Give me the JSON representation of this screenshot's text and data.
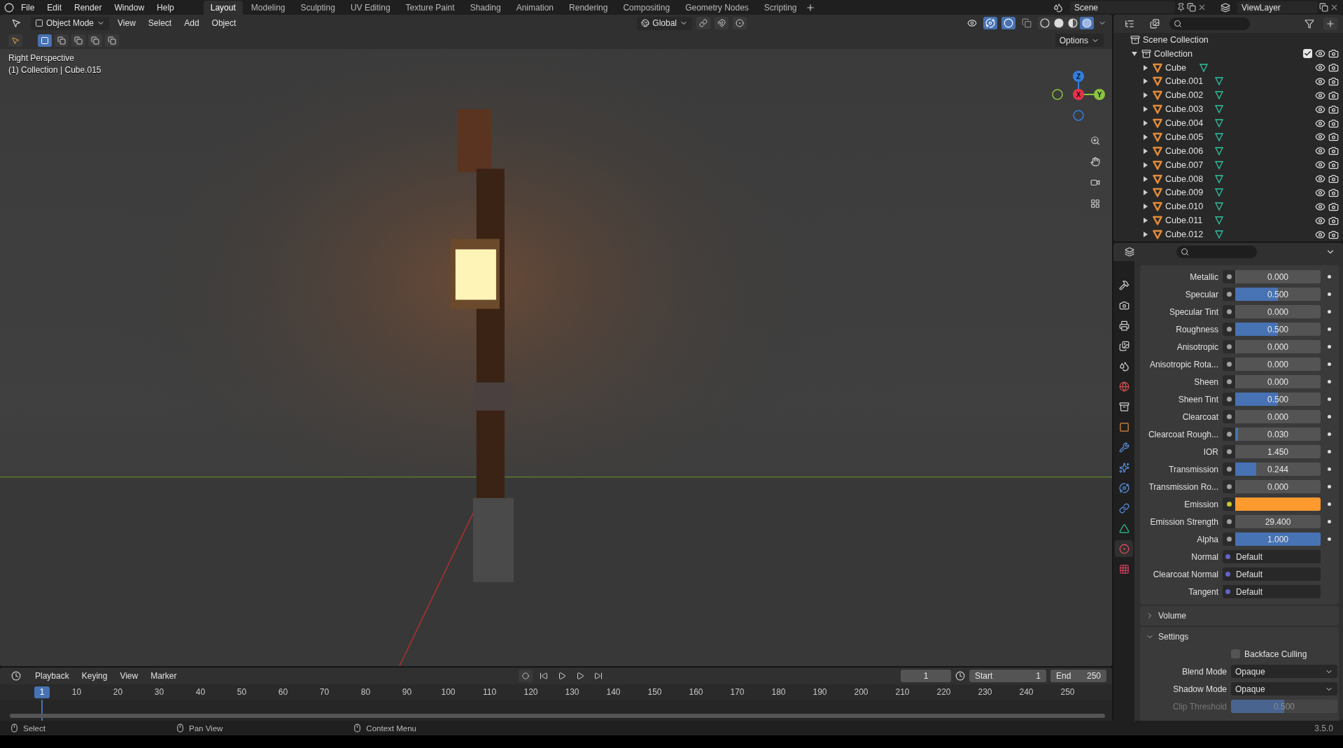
{
  "menu": [
    "File",
    "Edit",
    "Render",
    "Window",
    "Help"
  ],
  "workspaces": [
    {
      "label": "Layout",
      "selected": true
    },
    {
      "label": "Modeling",
      "selected": false
    },
    {
      "label": "Sculpting",
      "selected": false
    },
    {
      "label": "UV Editing",
      "selected": false
    },
    {
      "label": "Texture Paint",
      "selected": false
    },
    {
      "label": "Shading",
      "selected": false
    },
    {
      "label": "Animation",
      "selected": false
    },
    {
      "label": "Rendering",
      "selected": false
    },
    {
      "label": "Compositing",
      "selected": false
    },
    {
      "label": "Geometry Nodes",
      "selected": false
    },
    {
      "label": "Scripting",
      "selected": false
    }
  ],
  "scene": "Scene",
  "view_layer": "ViewLayer",
  "viewport": {
    "mode": "Object Mode",
    "menus": [
      "View",
      "Select",
      "Add",
      "Object"
    ],
    "orientation": "Global",
    "options": "Options",
    "info": [
      "Right Perspective",
      "(1) Collection | Cube.015"
    ],
    "axes": [
      {
        "label": "Z",
        "color": "#2f7fe0"
      },
      {
        "label": "X",
        "color": "#e8334a"
      },
      {
        "label": "Y",
        "color": "#8ac53f"
      }
    ],
    "shading": [
      {
        "kind": "wireframe",
        "selected": false
      },
      {
        "kind": "solid",
        "selected": false
      },
      {
        "kind": "material",
        "selected": false
      },
      {
        "kind": "rendered",
        "selected": true
      }
    ]
  },
  "outliner": {
    "items": [
      {
        "label": "Scene Collection",
        "kind": "scene",
        "children": [
          {
            "label": "Collection",
            "kind": "collection",
            "expanded": true,
            "checked": true,
            "children": [
              {
                "label": "Cube",
                "kind": "object",
                "expanded": false
              },
              {
                "label": "Cube.001",
                "kind": "object",
                "expanded": false
              },
              {
                "label": "Cube.002",
                "kind": "object",
                "expanded": false
              },
              {
                "label": "Cube.003",
                "kind": "object",
                "expanded": false
              },
              {
                "label": "Cube.004",
                "kind": "object",
                "expanded": false
              },
              {
                "label": "Cube.005",
                "kind": "object",
                "expanded": false
              },
              {
                "label": "Cube.006",
                "kind": "object",
                "expanded": false
              },
              {
                "label": "Cube.007",
                "kind": "object",
                "expanded": false
              },
              {
                "label": "Cube.008",
                "kind": "object",
                "expanded": false
              },
              {
                "label": "Cube.009",
                "kind": "object",
                "expanded": false
              },
              {
                "label": "Cube.010",
                "kind": "object",
                "expanded": false
              },
              {
                "label": "Cube.011",
                "kind": "object",
                "expanded": false
              },
              {
                "label": "Cube.012",
                "kind": "object",
                "expanded": false
              }
            ]
          }
        ]
      }
    ]
  },
  "property_tabs": [
    {
      "kind": "tool",
      "selected": false
    },
    {
      "kind": "render",
      "selected": false
    },
    {
      "kind": "output",
      "selected": false
    },
    {
      "kind": "view_layer",
      "selected": false
    },
    {
      "kind": "scene",
      "selected": false
    },
    {
      "kind": "world",
      "selected": false
    },
    {
      "kind": "collection",
      "selected": false
    },
    {
      "kind": "object",
      "selected": false
    },
    {
      "kind": "modifiers",
      "selected": false
    },
    {
      "kind": "particles",
      "selected": false
    },
    {
      "kind": "physics",
      "selected": false
    },
    {
      "kind": "constraints",
      "selected": false
    },
    {
      "kind": "data",
      "selected": false
    },
    {
      "kind": "material",
      "selected": true
    },
    {
      "kind": "texture",
      "selected": false
    }
  ],
  "properties": [
    {
      "label": "Metallic",
      "kind": "slider",
      "value": "0.000",
      "level": 0
    },
    {
      "label": "Specular",
      "kind": "slider",
      "value": "0.500",
      "level": 0.5
    },
    {
      "label": "Specular Tint",
      "kind": "slider",
      "value": "0.000",
      "level": 0
    },
    {
      "label": "Roughness",
      "kind": "slider",
      "value": "0.500",
      "level": 0.5
    },
    {
      "label": "Anisotropic",
      "kind": "slider",
      "value": "0.000",
      "level": 0
    },
    {
      "label": "Anisotropic Rota...",
      "kind": "slider",
      "value": "0.000",
      "level": 0
    },
    {
      "label": "Sheen",
      "kind": "slider",
      "value": "0.000",
      "level": 0
    },
    {
      "label": "Sheen Tint",
      "kind": "slider",
      "value": "0.500",
      "level": 0.5
    },
    {
      "label": "Clearcoat",
      "kind": "slider",
      "value": "0.000",
      "level": 0
    },
    {
      "label": "Clearcoat Rough...",
      "kind": "slider",
      "value": "0.030",
      "level": 0.03
    },
    {
      "label": "IOR",
      "kind": "number",
      "value": "1.450"
    },
    {
      "label": "Transmission",
      "kind": "slider",
      "value": "0.244",
      "level": 0.244
    },
    {
      "label": "Transmission Ro...",
      "kind": "slider",
      "value": "0.000",
      "level": 0
    },
    {
      "label": "Emission",
      "kind": "color",
      "color": "#ff9a2e"
    },
    {
      "label": "Emission Strength",
      "kind": "number",
      "value": "29.400"
    },
    {
      "label": "Alpha",
      "kind": "slider",
      "value": "1.000",
      "level": 1
    },
    {
      "label": "Normal",
      "kind": "link",
      "value": "Default"
    },
    {
      "label": "Clearcoat Normal",
      "kind": "link",
      "value": "Default"
    },
    {
      "label": "Tangent",
      "kind": "link",
      "value": "Default"
    }
  ],
  "panels": [
    {
      "title": "Volume",
      "expanded": false
    },
    {
      "title": "Settings",
      "expanded": true
    }
  ],
  "settings": {
    "backface_culling": {
      "label": "Backface Culling",
      "checked": false
    },
    "blend_mode": {
      "label": "Blend Mode",
      "value": "Opaque"
    },
    "shadow_mode": {
      "label": "Shadow Mode",
      "value": "Opaque"
    },
    "clip_threshold": {
      "label": "Clip Threshold",
      "value": "0.500",
      "level": 0.5,
      "disabled": true
    }
  },
  "timeline": {
    "menus": [
      "Playback",
      "Keying",
      "View",
      "Marker"
    ],
    "current_frame": "1",
    "start_label": "Start",
    "start": "1",
    "end_label": "End",
    "end": "250",
    "marker": "1",
    "ticks": [
      "10",
      "20",
      "30",
      "40",
      "50",
      "60",
      "70",
      "80",
      "90",
      "100",
      "110",
      "120",
      "130",
      "140",
      "150",
      "160",
      "170",
      "180",
      "190",
      "200",
      "210",
      "220",
      "230",
      "240",
      "250"
    ]
  },
  "status_bar": {
    "hints": [
      "Select",
      "Pan View",
      "Context Menu"
    ],
    "version": "3.5.0"
  }
}
